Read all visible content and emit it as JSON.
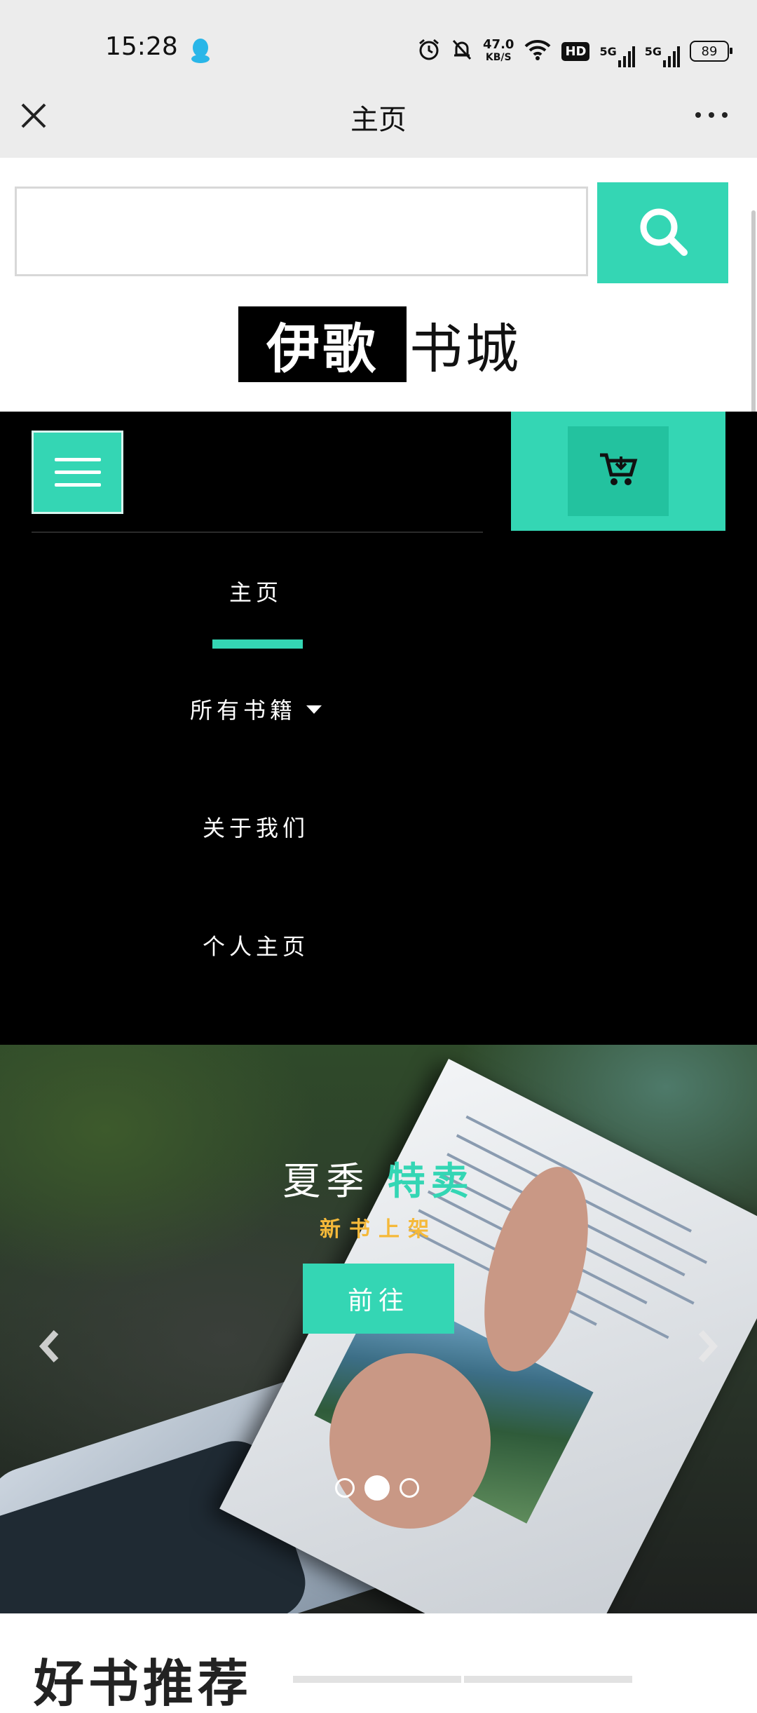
{
  "status_bar": {
    "time": "15:28",
    "net_speed_value": "47.0",
    "net_speed_unit": "KB/S",
    "hd_badge": "HD",
    "signal_1": "5G",
    "signal_2": "5G",
    "battery": "89"
  },
  "title_bar": {
    "title": "主页"
  },
  "search": {
    "placeholder": ""
  },
  "logo": {
    "highlight": "伊歌",
    "rest": "书城"
  },
  "nav": {
    "items": [
      {
        "label": "主页"
      },
      {
        "label": "所有书籍"
      },
      {
        "label": "关于我们"
      },
      {
        "label": "个人主页"
      }
    ]
  },
  "banner": {
    "title_plain": "夏季",
    "title_accent": "特卖",
    "subtitle": "新书上架",
    "button_label": "前往",
    "slide_count": 3,
    "active_slide": 2
  },
  "section": {
    "heading": "好书推荐"
  },
  "colors": {
    "accent": "#34d6b4",
    "accent_dark": "#23c29f",
    "subtitle": "#f5b93a",
    "nav_bg": "#000000",
    "bar_bg": "#ececec"
  }
}
